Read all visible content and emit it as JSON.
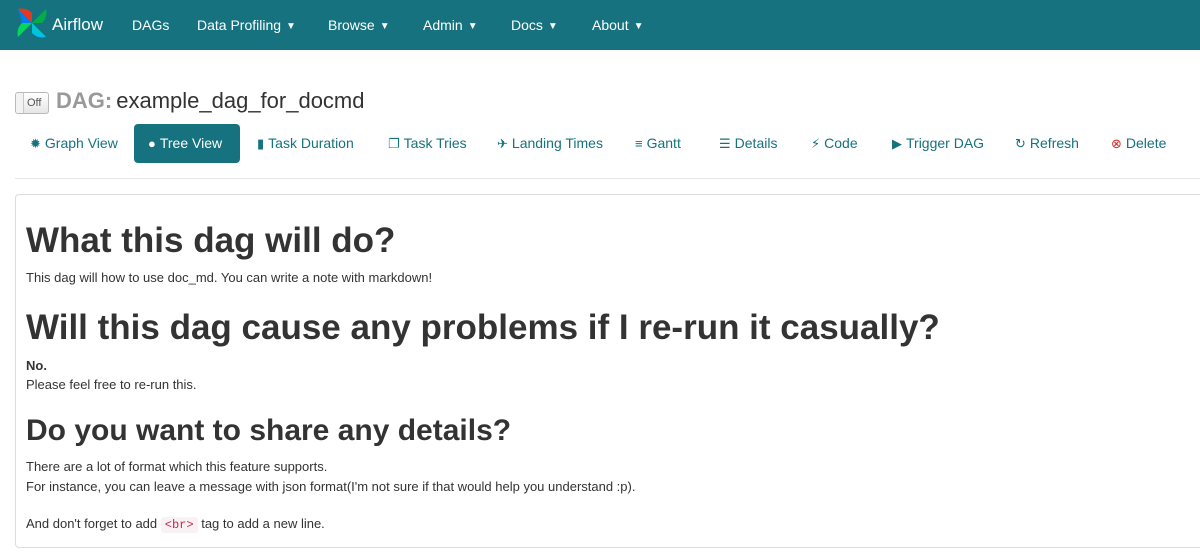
{
  "navbar": {
    "brand": "Airflow",
    "items": [
      {
        "label": "DAGs",
        "dropdown": false
      },
      {
        "label": "Data Profiling",
        "dropdown": true
      },
      {
        "label": "Browse",
        "dropdown": true
      },
      {
        "label": "Admin",
        "dropdown": true
      },
      {
        "label": "Docs",
        "dropdown": true
      },
      {
        "label": "About",
        "dropdown": true
      }
    ],
    "colors": {
      "background": "#16727f",
      "text": "#ffffff"
    }
  },
  "dag": {
    "toggle_label": "Off",
    "prefix": "DAG:",
    "id": "example_dag_for_docmd"
  },
  "tabs": [
    {
      "label": "Graph View",
      "icon": "graph-icon",
      "active": false
    },
    {
      "label": "Tree View",
      "icon": "tree-icon",
      "active": true
    },
    {
      "label": "Task Duration",
      "icon": "bar-chart-icon",
      "active": false
    },
    {
      "label": "Task Tries",
      "icon": "duplicate-icon",
      "active": false
    },
    {
      "label": "Landing Times",
      "icon": "plane-icon",
      "active": false
    },
    {
      "label": "Gantt",
      "icon": "align-left-icon",
      "active": false
    },
    {
      "label": "Details",
      "icon": "list-icon",
      "active": false
    },
    {
      "label": "Code",
      "icon": "flash-icon",
      "active": false
    },
    {
      "label": "Trigger DAG",
      "icon": "play-circle-icon",
      "active": false
    },
    {
      "label": "Refresh",
      "icon": "refresh-icon",
      "active": false
    },
    {
      "label": "Delete",
      "icon": "remove-circle-icon",
      "active": false
    }
  ],
  "doc": {
    "h1": "What this dag will do?",
    "p1": "This dag will how to use doc_md. You can write a note with markdown!",
    "h2a": "Will this dag cause any problems if I re-run it casually?",
    "bold_no": "No.",
    "p2": "Please feel free to re-run this.",
    "h2b": "Do you want to share any details?",
    "p3": "There are a lot of format which this feature supports.",
    "p4": "For instance, you can leave a message with json format(I'm not sure if that would help you understand :p).",
    "p5_before": "And don't forget to add",
    "p5_code": "<br>",
    "p5_after": "tag to add a new line."
  }
}
